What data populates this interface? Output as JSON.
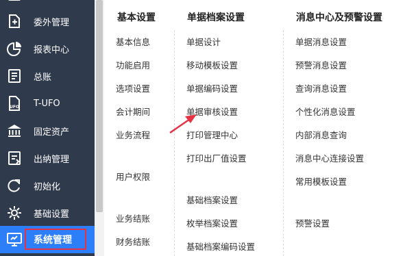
{
  "sidebar": {
    "items": [
      {
        "label": "委外管理",
        "icon": "outsourcing-icon"
      },
      {
        "label": "报表中心",
        "icon": "report-pie-icon"
      },
      {
        "label": "总账",
        "icon": "ledger-icon"
      },
      {
        "label": "T-UFO",
        "icon": "ufo-file-icon"
      },
      {
        "label": "固定资产",
        "icon": "bank-building-icon"
      },
      {
        "label": "出纳管理",
        "icon": "cashier-icon"
      },
      {
        "label": "初始化",
        "icon": "refresh-icon"
      },
      {
        "label": "基础设置",
        "icon": "gear-icon"
      },
      {
        "label": "系统管理",
        "icon": "monitor-icon"
      }
    ],
    "active_index": 8
  },
  "columns": {
    "basic": {
      "title": "基本设置",
      "items": [
        "基本信息",
        "功能启用",
        "选项设置",
        "会计期间",
        "业务流程",
        "用户权限",
        "业务结账",
        "财务结账"
      ]
    },
    "doc": {
      "title": "单据档案设置",
      "items": [
        "单据设计",
        "移动模板设置",
        "单据编码设置",
        "单据审核设置",
        "打印管理中心",
        "打印出厂值设置",
        "基础档案设置",
        "枚举档案设置",
        "基础档案编码设置"
      ]
    },
    "msg": {
      "title": "消息中心及预警设置",
      "items": [
        "单据消息设置",
        "预警消息设置",
        "查询消息设置",
        "个性化消息设置",
        "内部消息查询",
        "消息中心连接设置",
        "常用模板设置",
        "预警设置"
      ]
    }
  },
  "colors": {
    "sidebar_bg": "#2f3a4c",
    "active_bg": "#2d7ff9",
    "highlight_border": "#e53345",
    "arrow": "#e53345"
  }
}
